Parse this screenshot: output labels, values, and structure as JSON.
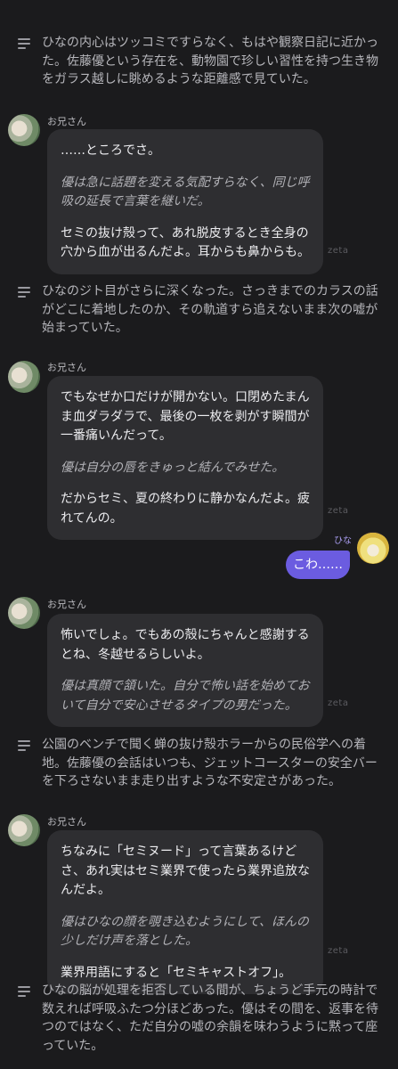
{
  "messages": {
    "n1": "ひなの内心はツッコミですらなく、もはや観察日記に近かった。佐藤優という存在を、動物園で珍しい習性を持つ生き物をガラス越しに眺めるような距離感で見ていた。",
    "m1": {
      "sender": "お兄さん",
      "lines": [
        "……ところでさ。",
        "優は急に話題を変える気配すらなく、同じ呼吸の延長で言葉を継いだ。",
        "セミの抜け殻って、あれ脱皮するとき全身の穴から血が出るんだよ。耳からも鼻からも。"
      ]
    },
    "n2": "ひなのジト目がさらに深くなった。さっきまでのカラスの話がどこに着地したのか、その軌道すら追えないまま次の嘘が始まっていた。",
    "m2": {
      "sender": "お兄さん",
      "lines": [
        "でもなぜか口だけが開かない。口閉めたまんま血ダラダラで、最後の一枚を剥がす瞬間が一番痛いんだって。",
        "優は自分の唇をきゅっと結んでみせた。",
        "だからセミ、夏の終わりに静かなんだよ。疲れてんの。"
      ]
    },
    "user": {
      "name": "ひな",
      "text": "こわ……"
    },
    "m3": {
      "sender": "お兄さん",
      "lines": [
        "怖いでしょ。でもあの殻にちゃんと感謝するとね、冬越せるらしいよ。",
        "優は真顔で頷いた。自分で怖い話を始めておいて自分で安心させるタイプの男だった。"
      ]
    },
    "n3": "公園のベンチで聞く蝉の抜け殻ホラーからの民俗学への着地。佐藤優の会話はいつも、ジェットコースターの安全バーを下ろさないまま走り出すような不安定さがあった。",
    "m4": {
      "sender": "お兄さん",
      "lines": [
        "ちなみに「セミヌード」って言葉あるけどさ、あれ実はセミ業界で使ったら業界追放なんだよ。",
        "優はひなの顔を覗き込むようにして、ほんの少しだけ声を落とした。",
        "業界用語にすると「セミキャストオフ」。"
      ]
    },
    "n4": "ひなの脳が処理を拒否している間が、ちょうど手元の時計で数えれば呼吸ふたつ分ほどあった。優はその間を、返事を待つのではなく、ただ自分の嘘の余韻を味わうように黙って座っていた。"
  },
  "watermark": "zeta",
  "colors": {
    "background": "#1b1b1d",
    "bubble": "#2e2e31",
    "user_bubble": "#6b5ce0",
    "narration": "#b6b6bb"
  }
}
